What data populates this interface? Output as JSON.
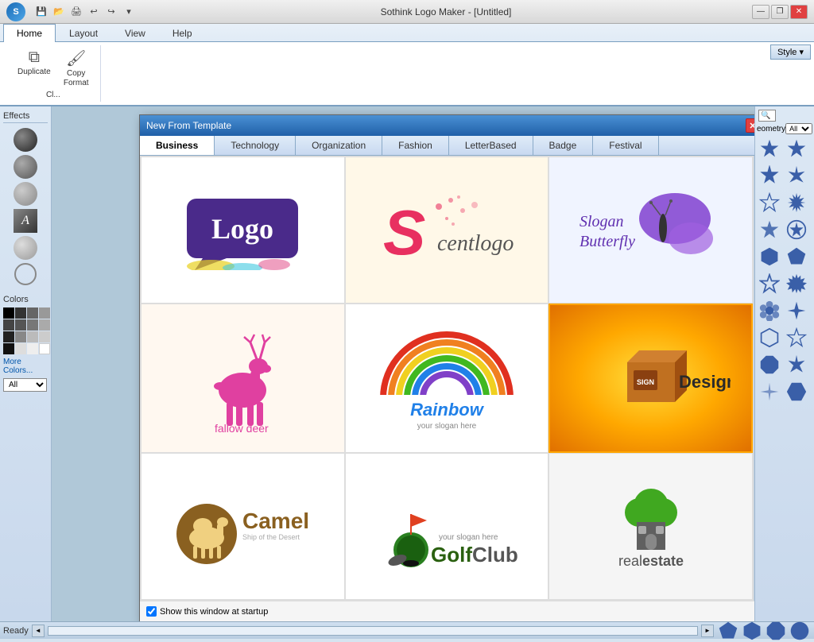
{
  "app": {
    "title": "Sothink Logo Maker - [Untitled]",
    "logo_text": "S"
  },
  "titlebar": {
    "min": "—",
    "restore": "❐",
    "close": "✕"
  },
  "quicktoolbar": {
    "buttons": [
      "💾",
      "📋",
      "↩",
      "↪",
      "▾"
    ]
  },
  "ribbon": {
    "tabs": [
      "Home",
      "Layout",
      "View",
      "Help"
    ],
    "active_tab": "Home",
    "style_label": "Style ▾",
    "groups": {
      "clipboard": {
        "duplicate_label": "Duplicate",
        "copy_format_label": "Copy Format",
        "clipboard_label": "Cl..."
      }
    }
  },
  "left_panel": {
    "effects_label": "Effects",
    "colors_label": "Colors",
    "more_colors": "More Colors...",
    "all_label": "All",
    "colors": [
      "#000000",
      "#333333",
      "#666666",
      "#999999",
      "#444444",
      "#555555",
      "#777777",
      "#aaaaaa",
      "#222222",
      "#888888",
      "#bbbbbb",
      "#cccccc",
      "#111111",
      "#dddddd",
      "#eeeeee",
      "#ffffff"
    ]
  },
  "right_panel": {
    "geometry_label": "eometry",
    "search_placeholder": "🔍"
  },
  "modal": {
    "title": "New From Template",
    "close_btn": "✕",
    "tabs": [
      "Business",
      "Technology",
      "Organization",
      "Fashion",
      "LetterBased",
      "Badge",
      "Festival"
    ],
    "active_tab": "Business",
    "templates": [
      {
        "id": "logo_template",
        "name": "Logo",
        "cell_class": "logo-business"
      },
      {
        "id": "scentlogo",
        "name": "Scentlogo",
        "cell_class": "logo-scentlogo"
      },
      {
        "id": "butterfly",
        "name": "Slogan Butterfly",
        "cell_class": "logo-butterfly"
      },
      {
        "id": "fallow_deer",
        "name": "fallow deer",
        "cell_class": "logo-deer"
      },
      {
        "id": "rainbow",
        "name": "Rainbow",
        "cell_class": "logo-rainbow"
      },
      {
        "id": "signdesign",
        "name": "SignDesign",
        "cell_class": "logo-signdesign",
        "selected": true
      },
      {
        "id": "camel",
        "name": "Camel",
        "cell_class": "logo-camel"
      },
      {
        "id": "golfclub",
        "name": "GolfClub",
        "cell_class": "logo-golf"
      },
      {
        "id": "realestate",
        "name": "realestate",
        "cell_class": "logo-realestate"
      }
    ],
    "footer_checkbox_label": "Show this window at startup"
  },
  "status": {
    "text": "Ready"
  }
}
